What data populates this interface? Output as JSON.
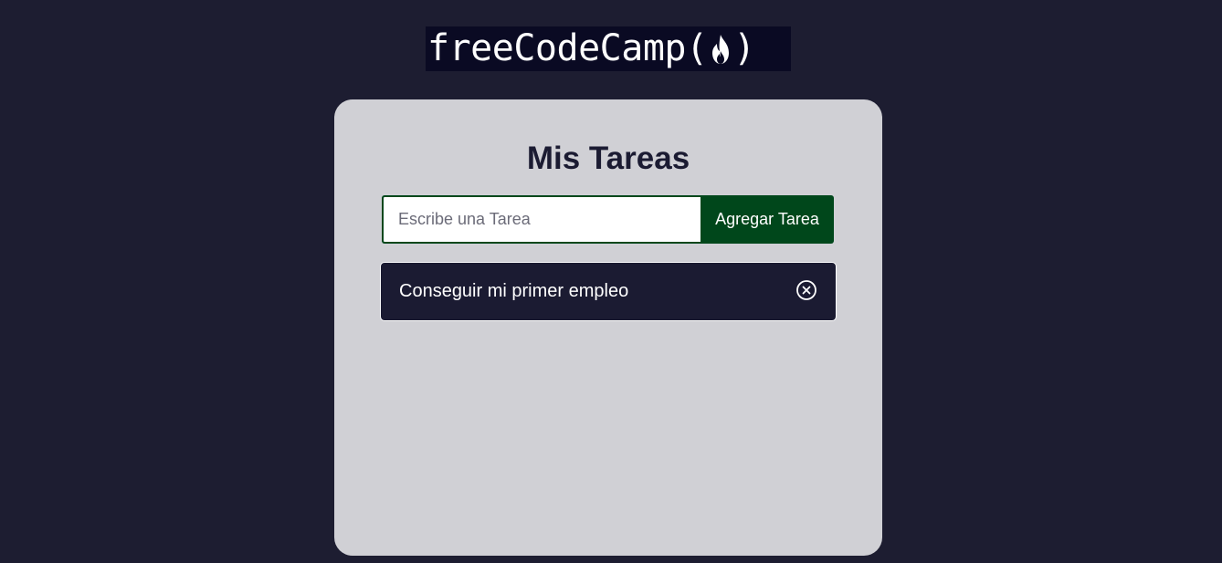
{
  "header": {
    "logo_text": "freeCodeCamp",
    "logo_paren_open": "(",
    "logo_paren_close": ")",
    "logo_icon": "flame-icon"
  },
  "app": {
    "title": "Mis Tareas",
    "input": {
      "placeholder": "Escribe una Tarea",
      "value": ""
    },
    "add_button_label": "Agregar Tarea",
    "tasks": [
      {
        "text": "Conseguir mi primer empleo",
        "icon": "close-circle-icon"
      }
    ]
  },
  "colors": {
    "background": "#1d1d31",
    "card": "#d0d0d5",
    "accent": "#00471b",
    "task_bg": "#1b1b32",
    "logo_bg": "#0a0a23"
  }
}
